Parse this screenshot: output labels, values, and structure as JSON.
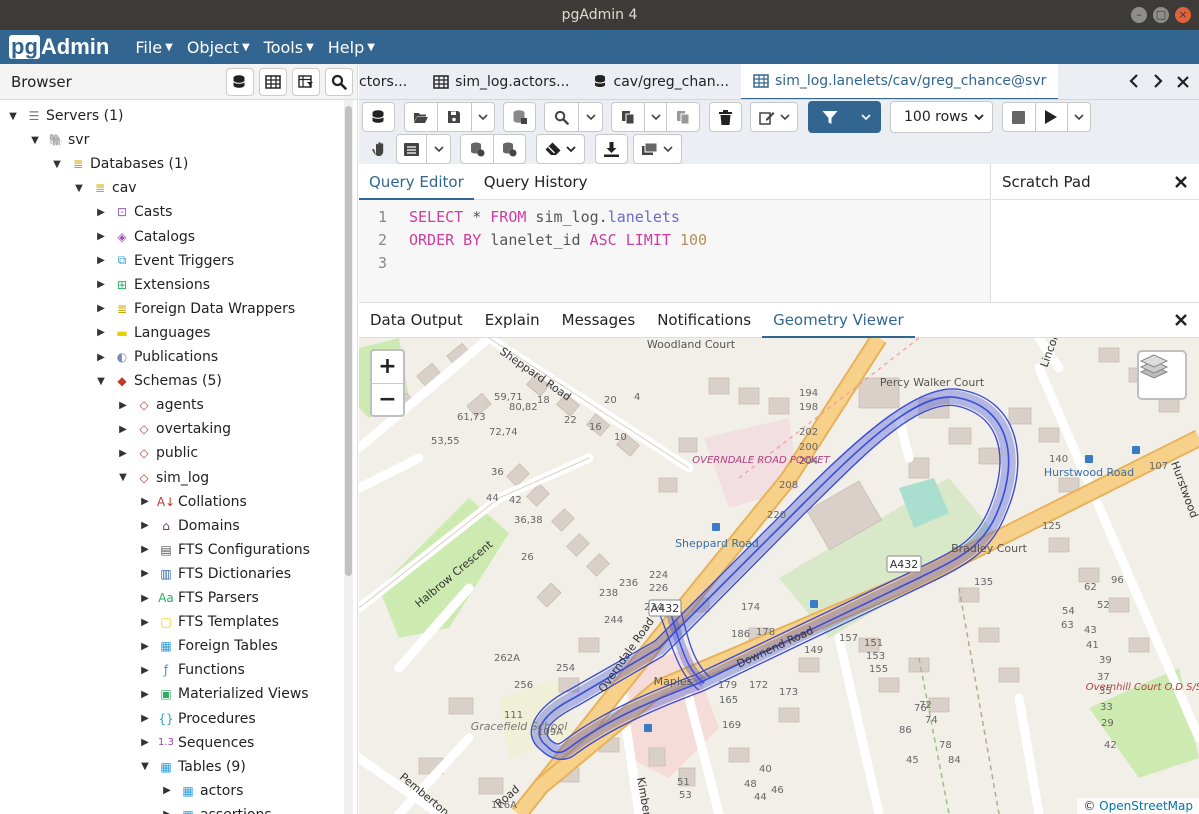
{
  "window": {
    "title": "pgAdmin 4"
  },
  "menubar": {
    "logo_pg": "pg",
    "logo_rest": "Admin",
    "items": [
      "File",
      "Object",
      "Tools",
      "Help"
    ]
  },
  "browser": {
    "title": "Browser",
    "tree": [
      {
        "label": "Servers (1)",
        "icon": "servers-icon",
        "depth": 0,
        "open": true
      },
      {
        "label": "svr",
        "icon": "elephant-icon",
        "depth": 1,
        "open": true
      },
      {
        "label": "Databases (1)",
        "icon": "databases-icon",
        "depth": 2,
        "open": true
      },
      {
        "label": "cav",
        "icon": "database-icon",
        "depth": 3,
        "open": true
      },
      {
        "label": "Casts",
        "icon": "casts-icon",
        "depth": 4,
        "open": false
      },
      {
        "label": "Catalogs",
        "icon": "catalogs-icon",
        "depth": 4,
        "open": false
      },
      {
        "label": "Event Triggers",
        "icon": "event-triggers-icon",
        "depth": 4,
        "open": false
      },
      {
        "label": "Extensions",
        "icon": "extensions-icon",
        "depth": 4,
        "open": false
      },
      {
        "label": "Foreign Data Wrappers",
        "icon": "fdw-icon",
        "depth": 4,
        "open": false
      },
      {
        "label": "Languages",
        "icon": "languages-icon",
        "depth": 4,
        "open": false
      },
      {
        "label": "Publications",
        "icon": "publications-icon",
        "depth": 4,
        "open": false
      },
      {
        "label": "Schemas (5)",
        "icon": "schemas-icon",
        "depth": 4,
        "open": true
      },
      {
        "label": "agents",
        "icon": "schema-icon",
        "depth": 5,
        "open": false
      },
      {
        "label": "overtaking",
        "icon": "schema-icon",
        "depth": 5,
        "open": false
      },
      {
        "label": "public",
        "icon": "schema-icon",
        "depth": 5,
        "open": false
      },
      {
        "label": "sim_log",
        "icon": "schema-icon",
        "depth": 5,
        "open": true
      },
      {
        "label": "Collations",
        "icon": "collations-icon",
        "depth": 6,
        "open": false
      },
      {
        "label": "Domains",
        "icon": "domains-icon",
        "depth": 6,
        "open": false
      },
      {
        "label": "FTS Configurations",
        "icon": "fts-config-icon",
        "depth": 6,
        "open": false
      },
      {
        "label": "FTS Dictionaries",
        "icon": "fts-dict-icon",
        "depth": 6,
        "open": false
      },
      {
        "label": "FTS Parsers",
        "icon": "fts-parsers-icon",
        "depth": 6,
        "open": false
      },
      {
        "label": "FTS Templates",
        "icon": "fts-templates-icon",
        "depth": 6,
        "open": false
      },
      {
        "label": "Foreign Tables",
        "icon": "foreign-tables-icon",
        "depth": 6,
        "open": false
      },
      {
        "label": "Functions",
        "icon": "functions-icon",
        "depth": 6,
        "open": false
      },
      {
        "label": "Materialized Views",
        "icon": "mat-views-icon",
        "depth": 6,
        "open": false
      },
      {
        "label": "Procedures",
        "icon": "procedures-icon",
        "depth": 6,
        "open": false
      },
      {
        "label": "Sequences",
        "icon": "sequences-icon",
        "depth": 6,
        "open": false
      },
      {
        "label": "Tables (9)",
        "icon": "tables-icon",
        "depth": 6,
        "open": true
      },
      {
        "label": "actors",
        "icon": "table-icon",
        "depth": 7,
        "open": false
      },
      {
        "label": "assertions",
        "icon": "table-icon",
        "depth": 7,
        "open": false
      }
    ]
  },
  "tabs": [
    {
      "label": "ctors...",
      "icon": "none",
      "active": false
    },
    {
      "label": "sim_log.actors...",
      "icon": "table-icon",
      "active": false
    },
    {
      "label": "cav/greg_chan...",
      "icon": "query-icon",
      "active": false
    },
    {
      "label": "sim_log.lanelets/cav/greg_chance@svr",
      "icon": "table-icon",
      "active": true
    }
  ],
  "toolbar": {
    "rows_value": "100 rows"
  },
  "editor": {
    "tabs": [
      "Query Editor",
      "Query History"
    ],
    "active_tab": "Query Editor",
    "lines": [
      {
        "num": "1",
        "parts": [
          [
            "kw",
            "SELECT"
          ],
          [
            "id",
            " * "
          ],
          [
            "kw",
            "FROM"
          ],
          [
            "id",
            " sim_log."
          ],
          [
            "kw2",
            "lanelets"
          ]
        ]
      },
      {
        "num": "2",
        "parts": [
          [
            "kw",
            "ORDER BY"
          ],
          [
            "id",
            " lanelet_id "
          ],
          [
            "kw",
            "ASC LIMIT"
          ],
          [
            "num",
            " 100"
          ]
        ]
      },
      {
        "num": "3",
        "parts": []
      }
    ]
  },
  "scratch": {
    "title": "Scratch Pad"
  },
  "results": {
    "tabs": [
      "Data Output",
      "Explain",
      "Messages",
      "Notifications",
      "Geometry Viewer"
    ],
    "active_tab": "Geometry Viewer"
  },
  "map": {
    "zoom_in": "+",
    "zoom_out": "−",
    "attribution_prefix": "©",
    "attribution_link": "OpenStreetMap",
    "labels": {
      "woodland_court": "Woodland Court",
      "sheppard_road": "Sheppard Road",
      "percy_walker": "Percy Walker Court",
      "overndale_pocket": "OVERNDALE ROAD POCKET",
      "sheppard_rd_stop": "Sheppard Road",
      "hurstwood": "Hurstwood Road",
      "bradley": "Bradley Court",
      "halbrow": "Halbrow Crescent",
      "downend": "Downend Road",
      "overndale": "Overndale Road",
      "a432_1": "A432",
      "a432_2": "A432",
      "maples": "Maples",
      "gracefield": "Gracefield School",
      "pemberton": "Pemberton Court",
      "overhill": "Overnhill Court O.D S/S",
      "kimber": "Kimber",
      "road": "Road",
      "lincoln": "Lincol",
      "hurstwood_rd": "Hurstwood"
    },
    "house_numbers": [
      "59,71",
      "61,73",
      "53,55",
      "80,82",
      "72,74",
      "36",
      "44",
      "42",
      "36,38",
      "26",
      "18",
      "22",
      "16",
      "10",
      "4",
      "20",
      "194",
      "198",
      "202",
      "200",
      "204",
      "208",
      "220",
      "224",
      "226",
      "234",
      "236",
      "238",
      "244",
      "254",
      "262A",
      "256",
      "111",
      "109A",
      "116A",
      "51",
      "53",
      "174",
      "178",
      "186",
      "172",
      "165",
      "169",
      "179",
      "173",
      "149",
      "157",
      "151",
      "153",
      "155",
      "135",
      "125",
      "107",
      "140",
      "96",
      "62",
      "52",
      "54",
      "63",
      "76",
      "72",
      "74",
      "78",
      "84",
      "86",
      "45",
      "43",
      "41",
      "39",
      "37",
      "35",
      "33",
      "29",
      "42",
      "40",
      "48",
      "44",
      "46"
    ],
    "accent": "#3b4cd6"
  }
}
